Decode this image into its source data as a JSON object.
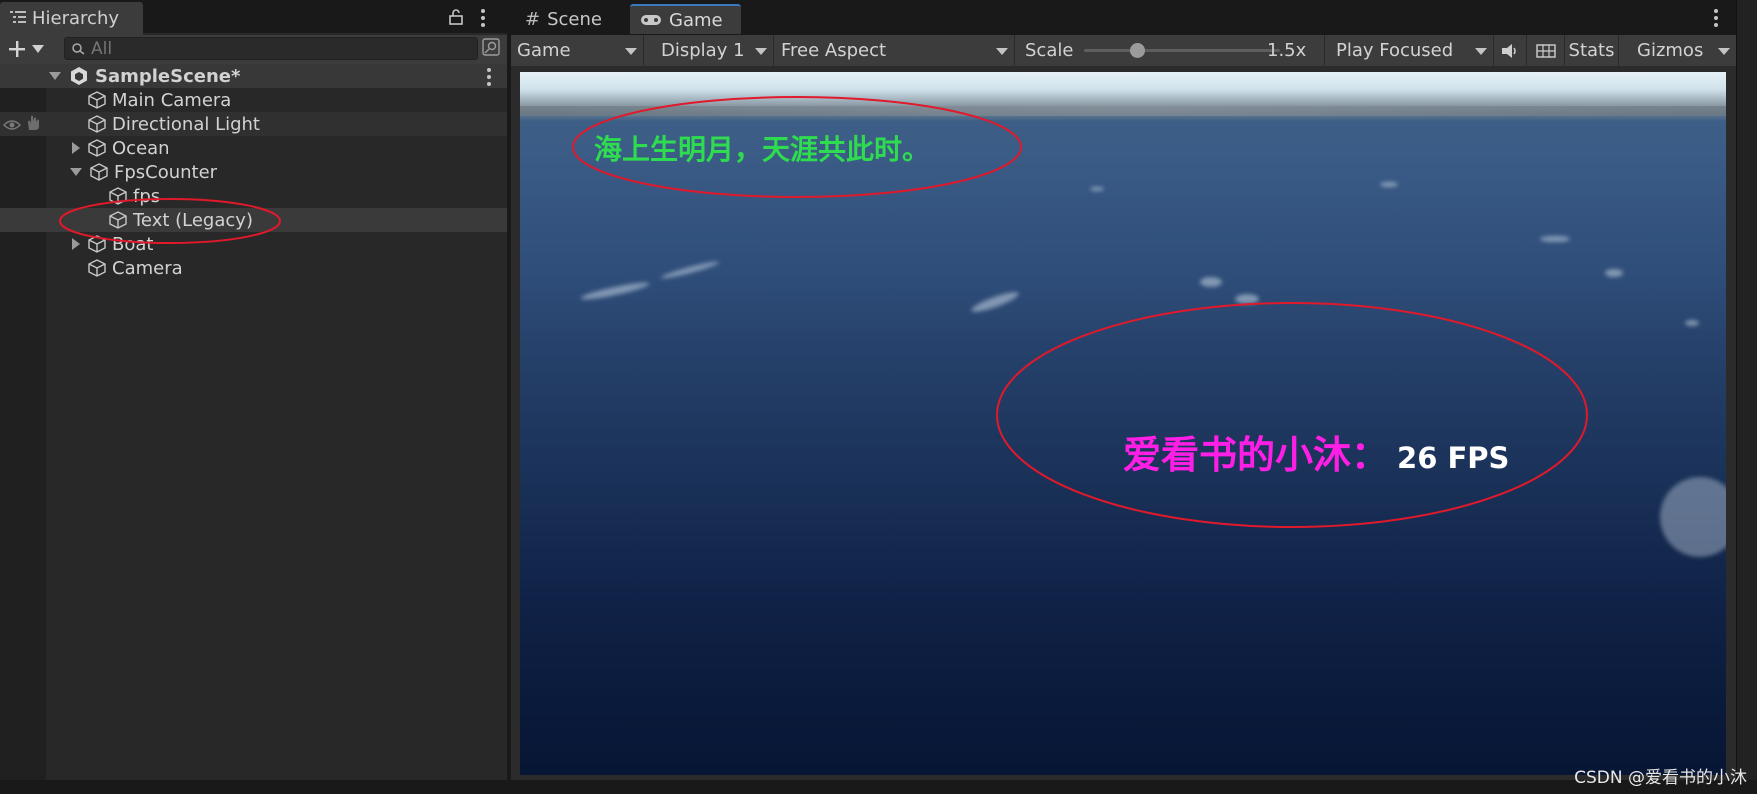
{
  "hierarchy": {
    "tab_label": "Hierarchy",
    "search_placeholder": "All",
    "scene_name": "SampleScene*",
    "items": [
      {
        "label": "Main Camera"
      },
      {
        "label": "Directional Light"
      },
      {
        "label": "Ocean"
      },
      {
        "label": "FpsCounter"
      },
      {
        "label": "fps"
      },
      {
        "label": "Text (Legacy)"
      },
      {
        "label": "Boat"
      },
      {
        "label": "Camera"
      }
    ]
  },
  "game_view": {
    "tabs": [
      {
        "label": "Scene"
      },
      {
        "label": "Game"
      }
    ],
    "toolbar": {
      "view_mode": "Game",
      "display": "Display 1",
      "aspect": "Free Aspect",
      "scale_label": "Scale",
      "scale_value": "1.5x",
      "scale_fraction": 0.27,
      "play_mode": "Play Focused",
      "stats_label": "Stats",
      "gizmos_label": "Gizmos"
    },
    "overlay": {
      "poem": "海上生明月，天涯共此时。",
      "fps_prefix": "爱看书的小沐：",
      "fps_value": "26 FPS"
    }
  },
  "watermark": "CSDN @爱看书的小沐",
  "colors": {
    "panel_bg": "#282828",
    "toolbar_bg": "#3c3c3c",
    "selection_bg": "#3a3a3a",
    "annotation_red": "#e0192b",
    "poem_green": "#2fdb4f",
    "fps_magenta": "#ff1ee6"
  }
}
